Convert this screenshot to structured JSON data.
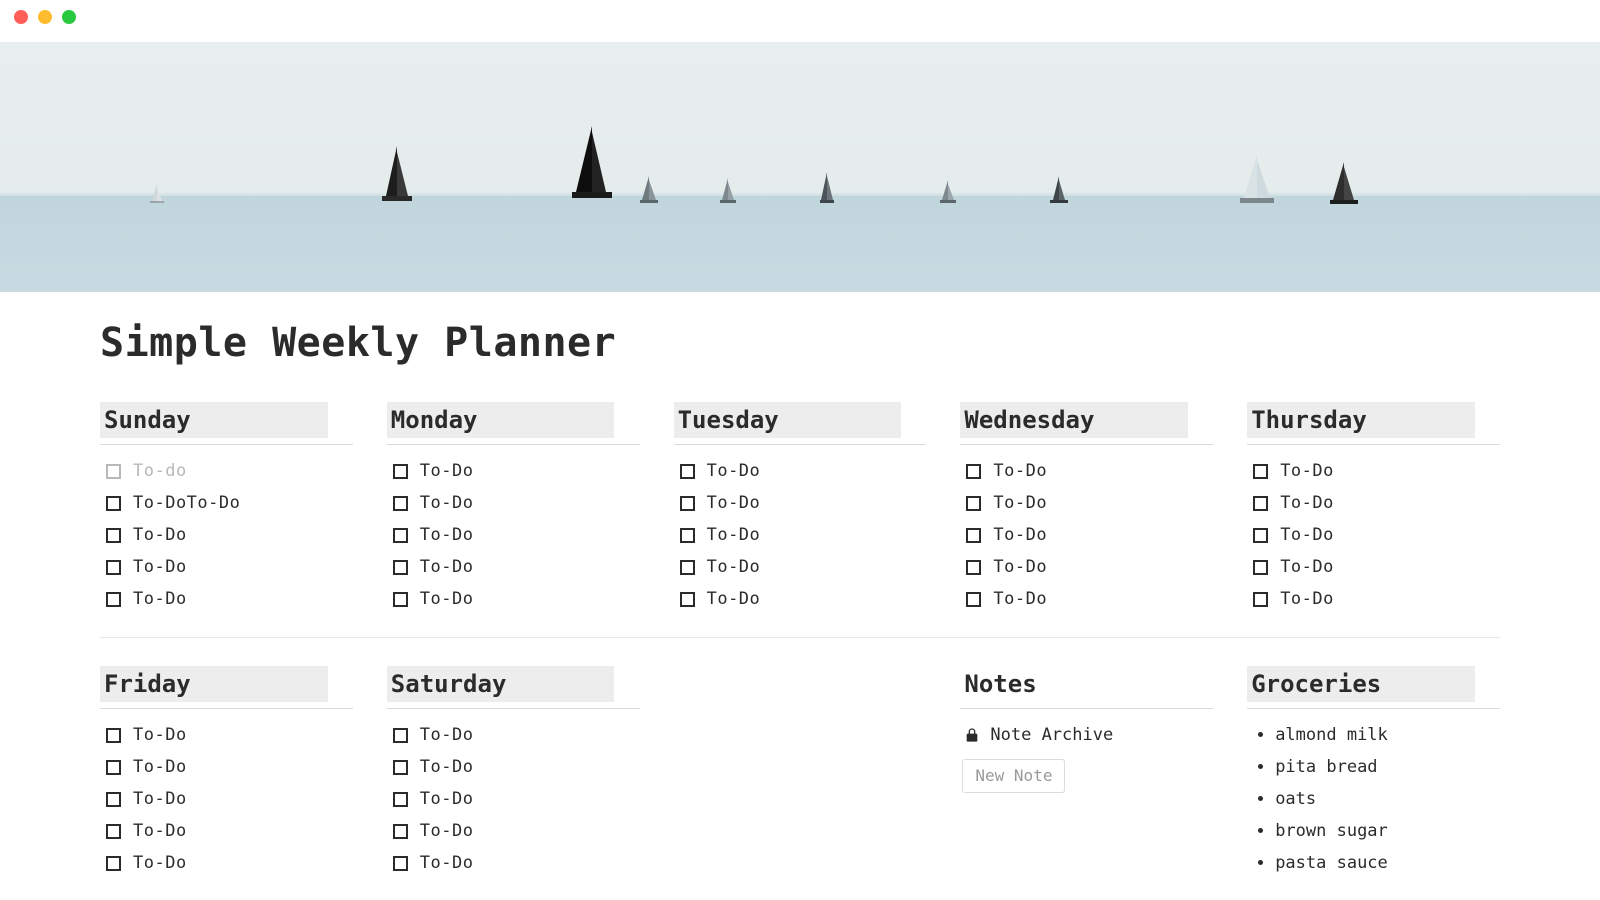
{
  "title": "Simple Weekly Planner",
  "days": [
    {
      "name": "Sunday",
      "items": [
        "To-do",
        "To-DoTo-Do",
        "To-Do",
        "To-Do",
        "To-Do"
      ],
      "placeholder_first": true
    },
    {
      "name": "Monday",
      "items": [
        "To-Do",
        "To-Do",
        "To-Do",
        "To-Do",
        "To-Do"
      ]
    },
    {
      "name": "Tuesday",
      "items": [
        "To-Do",
        "To-Do",
        "To-Do",
        "To-Do",
        "To-Do"
      ]
    },
    {
      "name": "Wednesday",
      "items": [
        "To-Do",
        "To-Do",
        "To-Do",
        "To-Do",
        "To-Do"
      ]
    },
    {
      "name": "Thursday",
      "items": [
        "To-Do",
        "To-Do",
        "To-Do",
        "To-Do",
        "To-Do"
      ]
    },
    {
      "name": "Friday",
      "items": [
        "To-Do",
        "To-Do",
        "To-Do",
        "To-Do",
        "To-Do"
      ]
    },
    {
      "name": "Saturday",
      "items": [
        "To-Do",
        "To-Do",
        "To-Do",
        "To-Do",
        "To-Do"
      ]
    }
  ],
  "notes": {
    "heading": "Notes",
    "archive_label": "Note Archive",
    "new_note_label": "New Note"
  },
  "groceries": {
    "heading": "Groceries",
    "items": [
      "almond milk",
      "pita bread",
      "oats",
      "brown sugar",
      "pasta sauce"
    ]
  }
}
